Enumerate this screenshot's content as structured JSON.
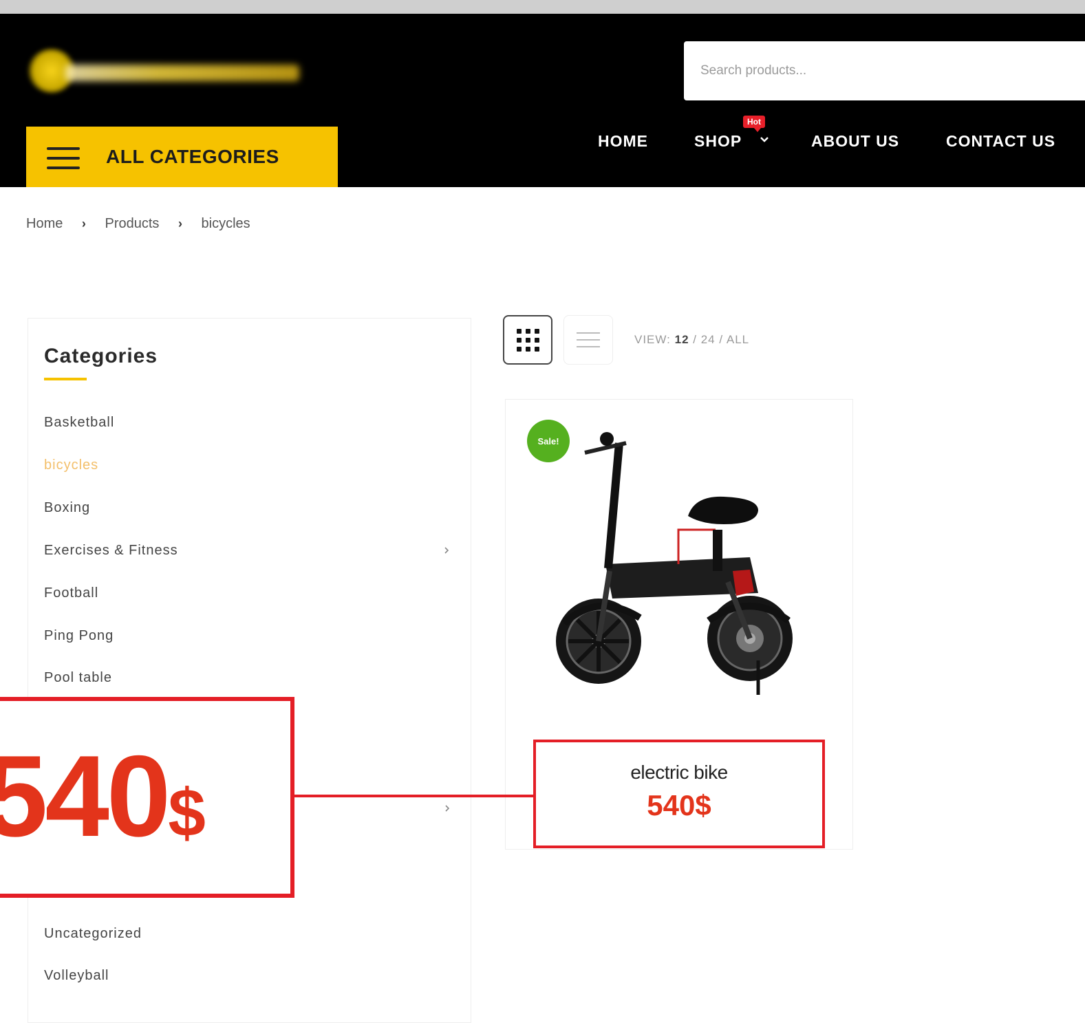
{
  "header": {
    "search_placeholder": "Search products...",
    "all_categories_label": "ALL CATEGORIES",
    "nav": [
      {
        "label": "HOME"
      },
      {
        "label": "SHOP"
      },
      {
        "label": "ABOUT US"
      },
      {
        "label": "CONTACT US"
      }
    ],
    "hot_badge": "Hot",
    "accent_color": "#f6c200"
  },
  "breadcrumb": [
    "Home",
    "Products",
    "bicycles"
  ],
  "sidebar": {
    "title": "Categories",
    "items": [
      {
        "label": "Basketball",
        "active": false
      },
      {
        "label": "bicycles",
        "active": true
      },
      {
        "label": "Boxing",
        "active": false
      },
      {
        "label": "Exercises & Fitness",
        "active": false,
        "has_children": true
      },
      {
        "label": "Football",
        "active": false
      },
      {
        "label": "Ping Pong",
        "active": false
      },
      {
        "label": "Pool table",
        "active": false
      },
      {
        "label": "Uncategorized",
        "active": false
      },
      {
        "label": "Volleyball",
        "active": false
      }
    ]
  },
  "toolbar": {
    "view_label": "VIEW:",
    "view_options": [
      "12",
      "24",
      "ALL"
    ],
    "view_current": "12"
  },
  "product": {
    "badge": "Sale!",
    "title": "electric bike",
    "price": "540$"
  },
  "callout": {
    "price_number": "540",
    "price_currency": "$"
  }
}
